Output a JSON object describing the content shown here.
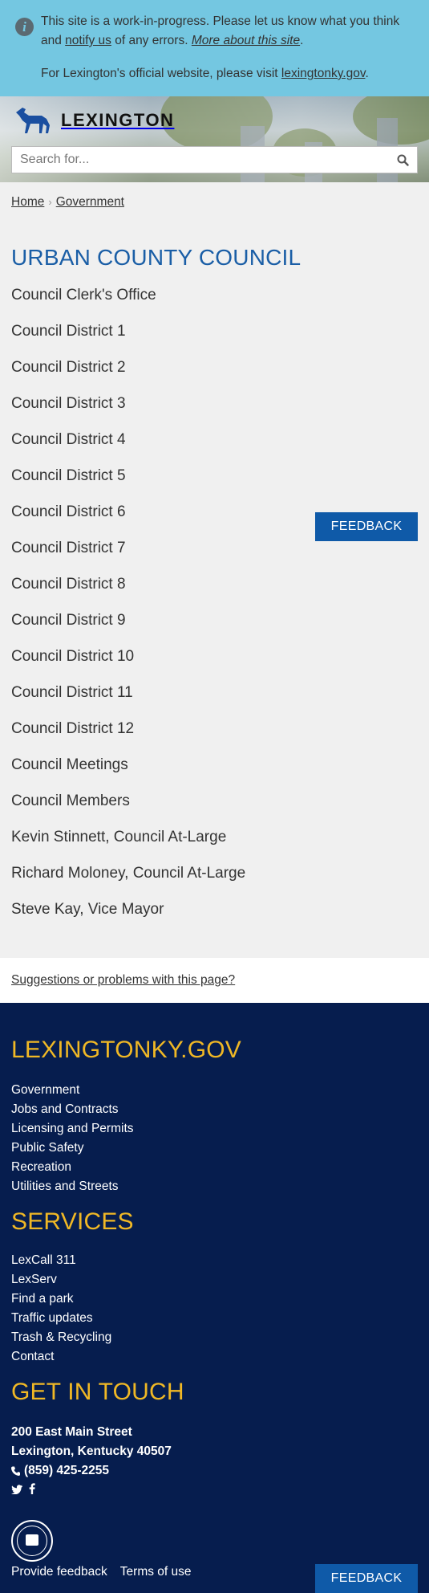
{
  "banner": {
    "line1_start": "This site is a work-in-progress. Please let us know what you think and ",
    "notify_link": "notify us",
    "line1_mid": " of any errors. ",
    "about_link": "More about this site",
    "line1_end": ".",
    "line2_start": "For Lexington's official website, please visit ",
    "official_link": "lexingtonky.gov",
    "line2_end": "."
  },
  "header": {
    "logo_text": "LEXINGTON",
    "search_placeholder": "Search for..."
  },
  "breadcrumb": {
    "home": "Home",
    "separator": "›",
    "current": "Government"
  },
  "page": {
    "title": "URBAN COUNTY COUNCIL",
    "links": [
      "Council Clerk's Office",
      "Council District 1",
      "Council District 2",
      "Council District 3",
      "Council District 4",
      "Council District 5",
      "Council District 6",
      "Council District 7",
      "Council District 8",
      "Council District 9",
      "Council District 10",
      "Council District 11",
      "Council District 12",
      "Council Meetings",
      "Council Members",
      "Kevin Stinnett, Council At-Large",
      "Richard Moloney, Council At-Large",
      "Steve Kay, Vice Mayor"
    ]
  },
  "feedback": {
    "label": "FEEDBACK"
  },
  "suggest": {
    "label": "Suggestions or problems with this page?"
  },
  "footer": {
    "site_heading": "LEXINGTONKY.GOV",
    "site_links": [
      "Government",
      "Jobs and Contracts",
      "Licensing and Permits",
      "Public Safety",
      "Recreation",
      "Utilities and Streets"
    ],
    "services_heading": "SERVICES",
    "services_links": [
      "LexCall 311",
      "LexServ",
      "Find a park",
      "Traffic updates",
      "Trash & Recycling",
      "Contact"
    ],
    "contact_heading": "GET IN TOUCH",
    "address_line1": "200 East Main Street",
    "address_line2": "Lexington, Kentucky 40507",
    "phone": "(859) 425-2255",
    "feedback_link": "Provide feedback",
    "terms_link": "Terms of use"
  },
  "colors": {
    "banner": "#74c7e1",
    "title_blue": "#1a5ea6",
    "button_blue": "#0f5aa8",
    "footer_navy": "#061d4e",
    "footer_gold": "#f0b825"
  }
}
